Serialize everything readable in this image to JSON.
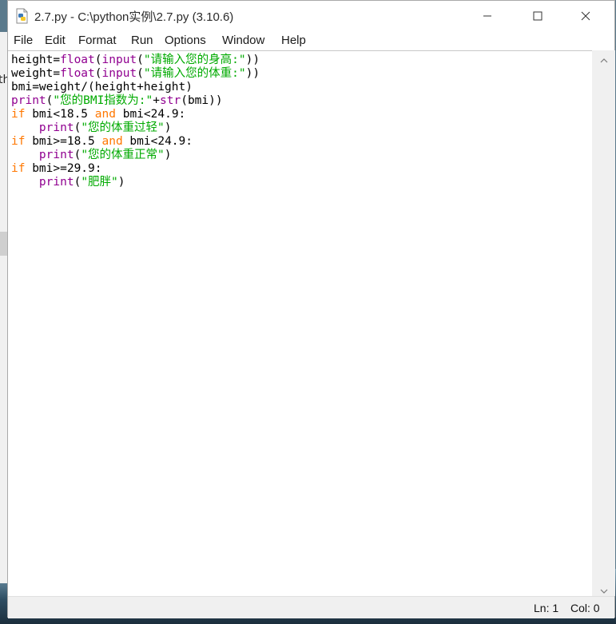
{
  "window": {
    "title": "2.7.py - C:\\python实例\\2.7.py (3.10.6)"
  },
  "menu": {
    "items": [
      "File",
      "Edit",
      "Format",
      "Run",
      "Options",
      "Window",
      "Help"
    ]
  },
  "editor": {
    "lines": [
      [
        {
          "t": "height=",
          "c": ""
        },
        {
          "t": "float",
          "c": "bi"
        },
        {
          "t": "(",
          "c": ""
        },
        {
          "t": "input",
          "c": "bi"
        },
        {
          "t": "(",
          "c": ""
        },
        {
          "t": "\"请输入您的身高:\"",
          "c": "st"
        },
        {
          "t": "))",
          "c": ""
        }
      ],
      [
        {
          "t": "weight=",
          "c": ""
        },
        {
          "t": "float",
          "c": "bi"
        },
        {
          "t": "(",
          "c": ""
        },
        {
          "t": "input",
          "c": "bi"
        },
        {
          "t": "(",
          "c": ""
        },
        {
          "t": "\"请输入您的体重:\"",
          "c": "st"
        },
        {
          "t": "))",
          "c": ""
        }
      ],
      [
        {
          "t": "bmi=weight/(height+height)",
          "c": ""
        }
      ],
      [
        {
          "t": "print",
          "c": "bi"
        },
        {
          "t": "(",
          "c": ""
        },
        {
          "t": "\"您的BMI指数为:\"",
          "c": "st"
        },
        {
          "t": "+",
          "c": ""
        },
        {
          "t": "str",
          "c": "bi"
        },
        {
          "t": "(bmi))",
          "c": ""
        }
      ],
      [
        {
          "t": "if",
          "c": "kw"
        },
        {
          "t": " bmi<18.5 ",
          "c": ""
        },
        {
          "t": "and",
          "c": "kw"
        },
        {
          "t": " bmi<24.9:",
          "c": ""
        }
      ],
      [
        {
          "t": "    ",
          "c": ""
        },
        {
          "t": "print",
          "c": "bi"
        },
        {
          "t": "(",
          "c": ""
        },
        {
          "t": "\"您的体重过轻\"",
          "c": "st"
        },
        {
          "t": ")",
          "c": ""
        }
      ],
      [
        {
          "t": "if",
          "c": "kw"
        },
        {
          "t": " bmi>=18.5 ",
          "c": ""
        },
        {
          "t": "and",
          "c": "kw"
        },
        {
          "t": " bmi<24.9:",
          "c": ""
        }
      ],
      [
        {
          "t": "    ",
          "c": ""
        },
        {
          "t": "print",
          "c": "bi"
        },
        {
          "t": "(",
          "c": ""
        },
        {
          "t": "\"您的体重正常\"",
          "c": "st"
        },
        {
          "t": ")",
          "c": ""
        }
      ],
      [
        {
          "t": "if",
          "c": "kw"
        },
        {
          "t": " bmi>=29.9:",
          "c": ""
        }
      ],
      [
        {
          "t": "    ",
          "c": ""
        },
        {
          "t": "print",
          "c": "bi"
        },
        {
          "t": "(",
          "c": ""
        },
        {
          "t": "\"肥胖\"",
          "c": "st"
        },
        {
          "t": ")",
          "c": ""
        }
      ]
    ]
  },
  "status": {
    "line": "Ln: 1",
    "col": "Col: 0"
  },
  "background": {
    "left_peek": "th",
    "right_peek": "0"
  },
  "colors": {
    "keyword": "#ff7700",
    "builtin": "#900090",
    "string": "#00aa00"
  },
  "icons": [
    "python-file-icon",
    "minimize-icon",
    "maximize-icon",
    "close-icon",
    "scroll-up-icon",
    "scroll-down-icon"
  ]
}
